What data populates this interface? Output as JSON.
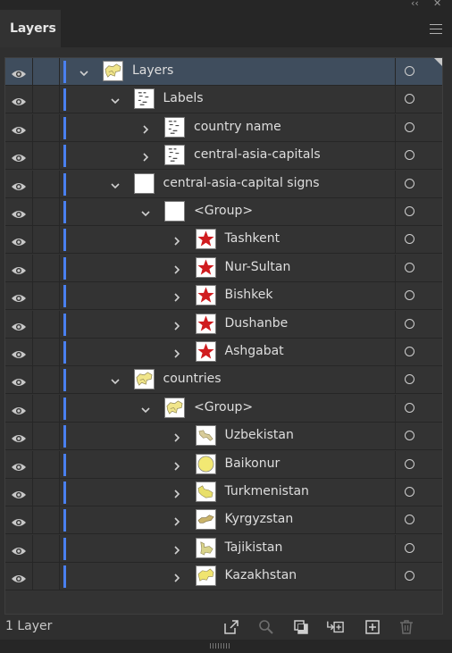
{
  "panel": {
    "tab_label": "Layers",
    "window_controls": {
      "collapse": "‹‹",
      "close": "✕"
    },
    "footer_count": "1 Layer"
  },
  "accent": {
    "layer_color": "#4a80f0",
    "selected_row": "#3f4d5d",
    "star_red": "#d01c1f"
  },
  "rows": [
    {
      "label": "Layers",
      "depth": 0,
      "expanded": true,
      "thumb": "map-icon",
      "selected": true
    },
    {
      "label": "Labels",
      "depth": 1,
      "expanded": true,
      "thumb": "text-icon"
    },
    {
      "label": "country name",
      "depth": 2,
      "expanded": false,
      "thumb": "text-icon"
    },
    {
      "label": "central-asia-capitals",
      "depth": 2,
      "expanded": false,
      "thumb": "text-icon"
    },
    {
      "label": "central-asia-capital signs",
      "depth": 1,
      "expanded": true,
      "thumb": "blank-icon"
    },
    {
      "label": "<Group>",
      "depth": 2,
      "expanded": true,
      "thumb": "blank-icon"
    },
    {
      "label": "Tashkent",
      "depth": 3,
      "expanded": false,
      "thumb": "star-icon"
    },
    {
      "label": "Nur-Sultan",
      "depth": 3,
      "expanded": false,
      "thumb": "star-icon"
    },
    {
      "label": "Bishkek",
      "depth": 3,
      "expanded": false,
      "thumb": "star-icon"
    },
    {
      "label": "Dushanbe",
      "depth": 3,
      "expanded": false,
      "thumb": "star-icon"
    },
    {
      "label": "Ashgabat",
      "depth": 3,
      "expanded": false,
      "thumb": "star-icon"
    },
    {
      "label": "countries",
      "depth": 1,
      "expanded": true,
      "thumb": "map-icon"
    },
    {
      "label": "<Group>",
      "depth": 2,
      "expanded": true,
      "thumb": "map-icon"
    },
    {
      "label": "Uzbekistan",
      "depth": 3,
      "expanded": false,
      "thumb": "uzbekistan-shape-icon"
    },
    {
      "label": "Baikonur",
      "depth": 3,
      "expanded": false,
      "thumb": "circle-icon"
    },
    {
      "label": "Turkmenistan",
      "depth": 3,
      "expanded": false,
      "thumb": "turkmenistan-shape-icon"
    },
    {
      "label": "Kyrgyzstan",
      "depth": 3,
      "expanded": false,
      "thumb": "kyrgyzstan-shape-icon"
    },
    {
      "label": "Tajikistan",
      "depth": 3,
      "expanded": false,
      "thumb": "tajikistan-shape-icon"
    },
    {
      "label": "Kazakhstan",
      "depth": 3,
      "expanded": false,
      "thumb": "kazakhstan-shape-icon"
    }
  ],
  "footer_icons": [
    "export-icon",
    "locate-object-icon",
    "make-clipping-mask-icon",
    "new-sublayer-icon",
    "new-layer-icon",
    "delete-icon"
  ]
}
